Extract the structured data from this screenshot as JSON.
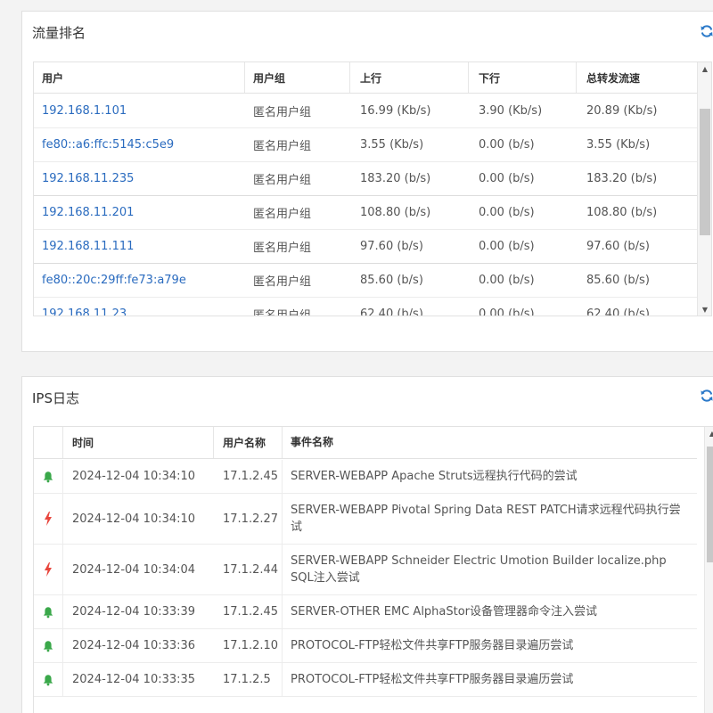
{
  "traffic_panel": {
    "title": "流量排名",
    "columns": [
      "用户",
      "用户组",
      "上行",
      "下行",
      "总转发流速"
    ],
    "rows": [
      [
        "192.168.1.101",
        "匿名用户组",
        "16.99 (Kb/s)",
        "3.90 (Kb/s)",
        "20.89 (Kb/s)"
      ],
      [
        "fe80::a6:ffc:5145:c5e9",
        "匿名用户组",
        "3.55 (Kb/s)",
        "0.00 (b/s)",
        "3.55 (Kb/s)"
      ],
      [
        "192.168.11.235",
        "匿名用户组",
        "183.20 (b/s)",
        "0.00 (b/s)",
        "183.20 (b/s)"
      ],
      [
        "192.168.11.201",
        "匿名用户组",
        "108.80 (b/s)",
        "0.00 (b/s)",
        "108.80 (b/s)"
      ],
      [
        "192.168.11.111",
        "匿名用户组",
        "97.60 (b/s)",
        "0.00 (b/s)",
        "97.60 (b/s)"
      ],
      [
        "fe80::20c:29ff:fe73:a79e",
        "匿名用户组",
        "85.60 (b/s)",
        "0.00 (b/s)",
        "85.60 (b/s)"
      ],
      [
        "192.168.11.23",
        "匿名用户组",
        "62.40 (b/s)",
        "0.00 (b/s)",
        "62.40 (b/s)"
      ]
    ]
  },
  "ips_panel": {
    "title": "IPS日志",
    "columns": [
      "",
      "时间",
      "用户名称",
      "事件名称"
    ],
    "rows": [
      {
        "icon": "bell-icon",
        "time": "2024-12-04 10:34:10",
        "user": "17.1.2.45",
        "event": "SERVER-WEBAPP Apache Struts远程执行代码的尝试"
      },
      {
        "icon": "bolt-icon",
        "time": "2024-12-04 10:34:10",
        "user": "17.1.2.27",
        "event": "SERVER-WEBAPP Pivotal Spring Data REST PATCH请求远程代码执行尝试"
      },
      {
        "icon": "bolt-icon",
        "time": "2024-12-04 10:34:04",
        "user": "17.1.2.44",
        "event": "SERVER-WEBAPP Schneider Electric Umotion Builder localize.php SQL注入尝试"
      },
      {
        "icon": "bell-icon",
        "time": "2024-12-04 10:33:39",
        "user": "17.1.2.45",
        "event": "SERVER-OTHER EMC AlphaStor设备管理器命令注入尝试"
      },
      {
        "icon": "bell-icon",
        "time": "2024-12-04 10:33:36",
        "user": "17.1.2.10",
        "event": "PROTOCOL-FTP轻松文件共享FTP服务器目录遍历尝试"
      },
      {
        "icon": "bell-icon",
        "time": "2024-12-04 10:33:35",
        "user": "17.1.2.5",
        "event": "PROTOCOL-FTP轻松文件共享FTP服务器目录遍历尝试"
      }
    ]
  },
  "colors": {
    "link": "#2a6bbf",
    "refresh": "#2a79c9",
    "bell": "#3aa84a",
    "bolt": "#e8453c"
  }
}
